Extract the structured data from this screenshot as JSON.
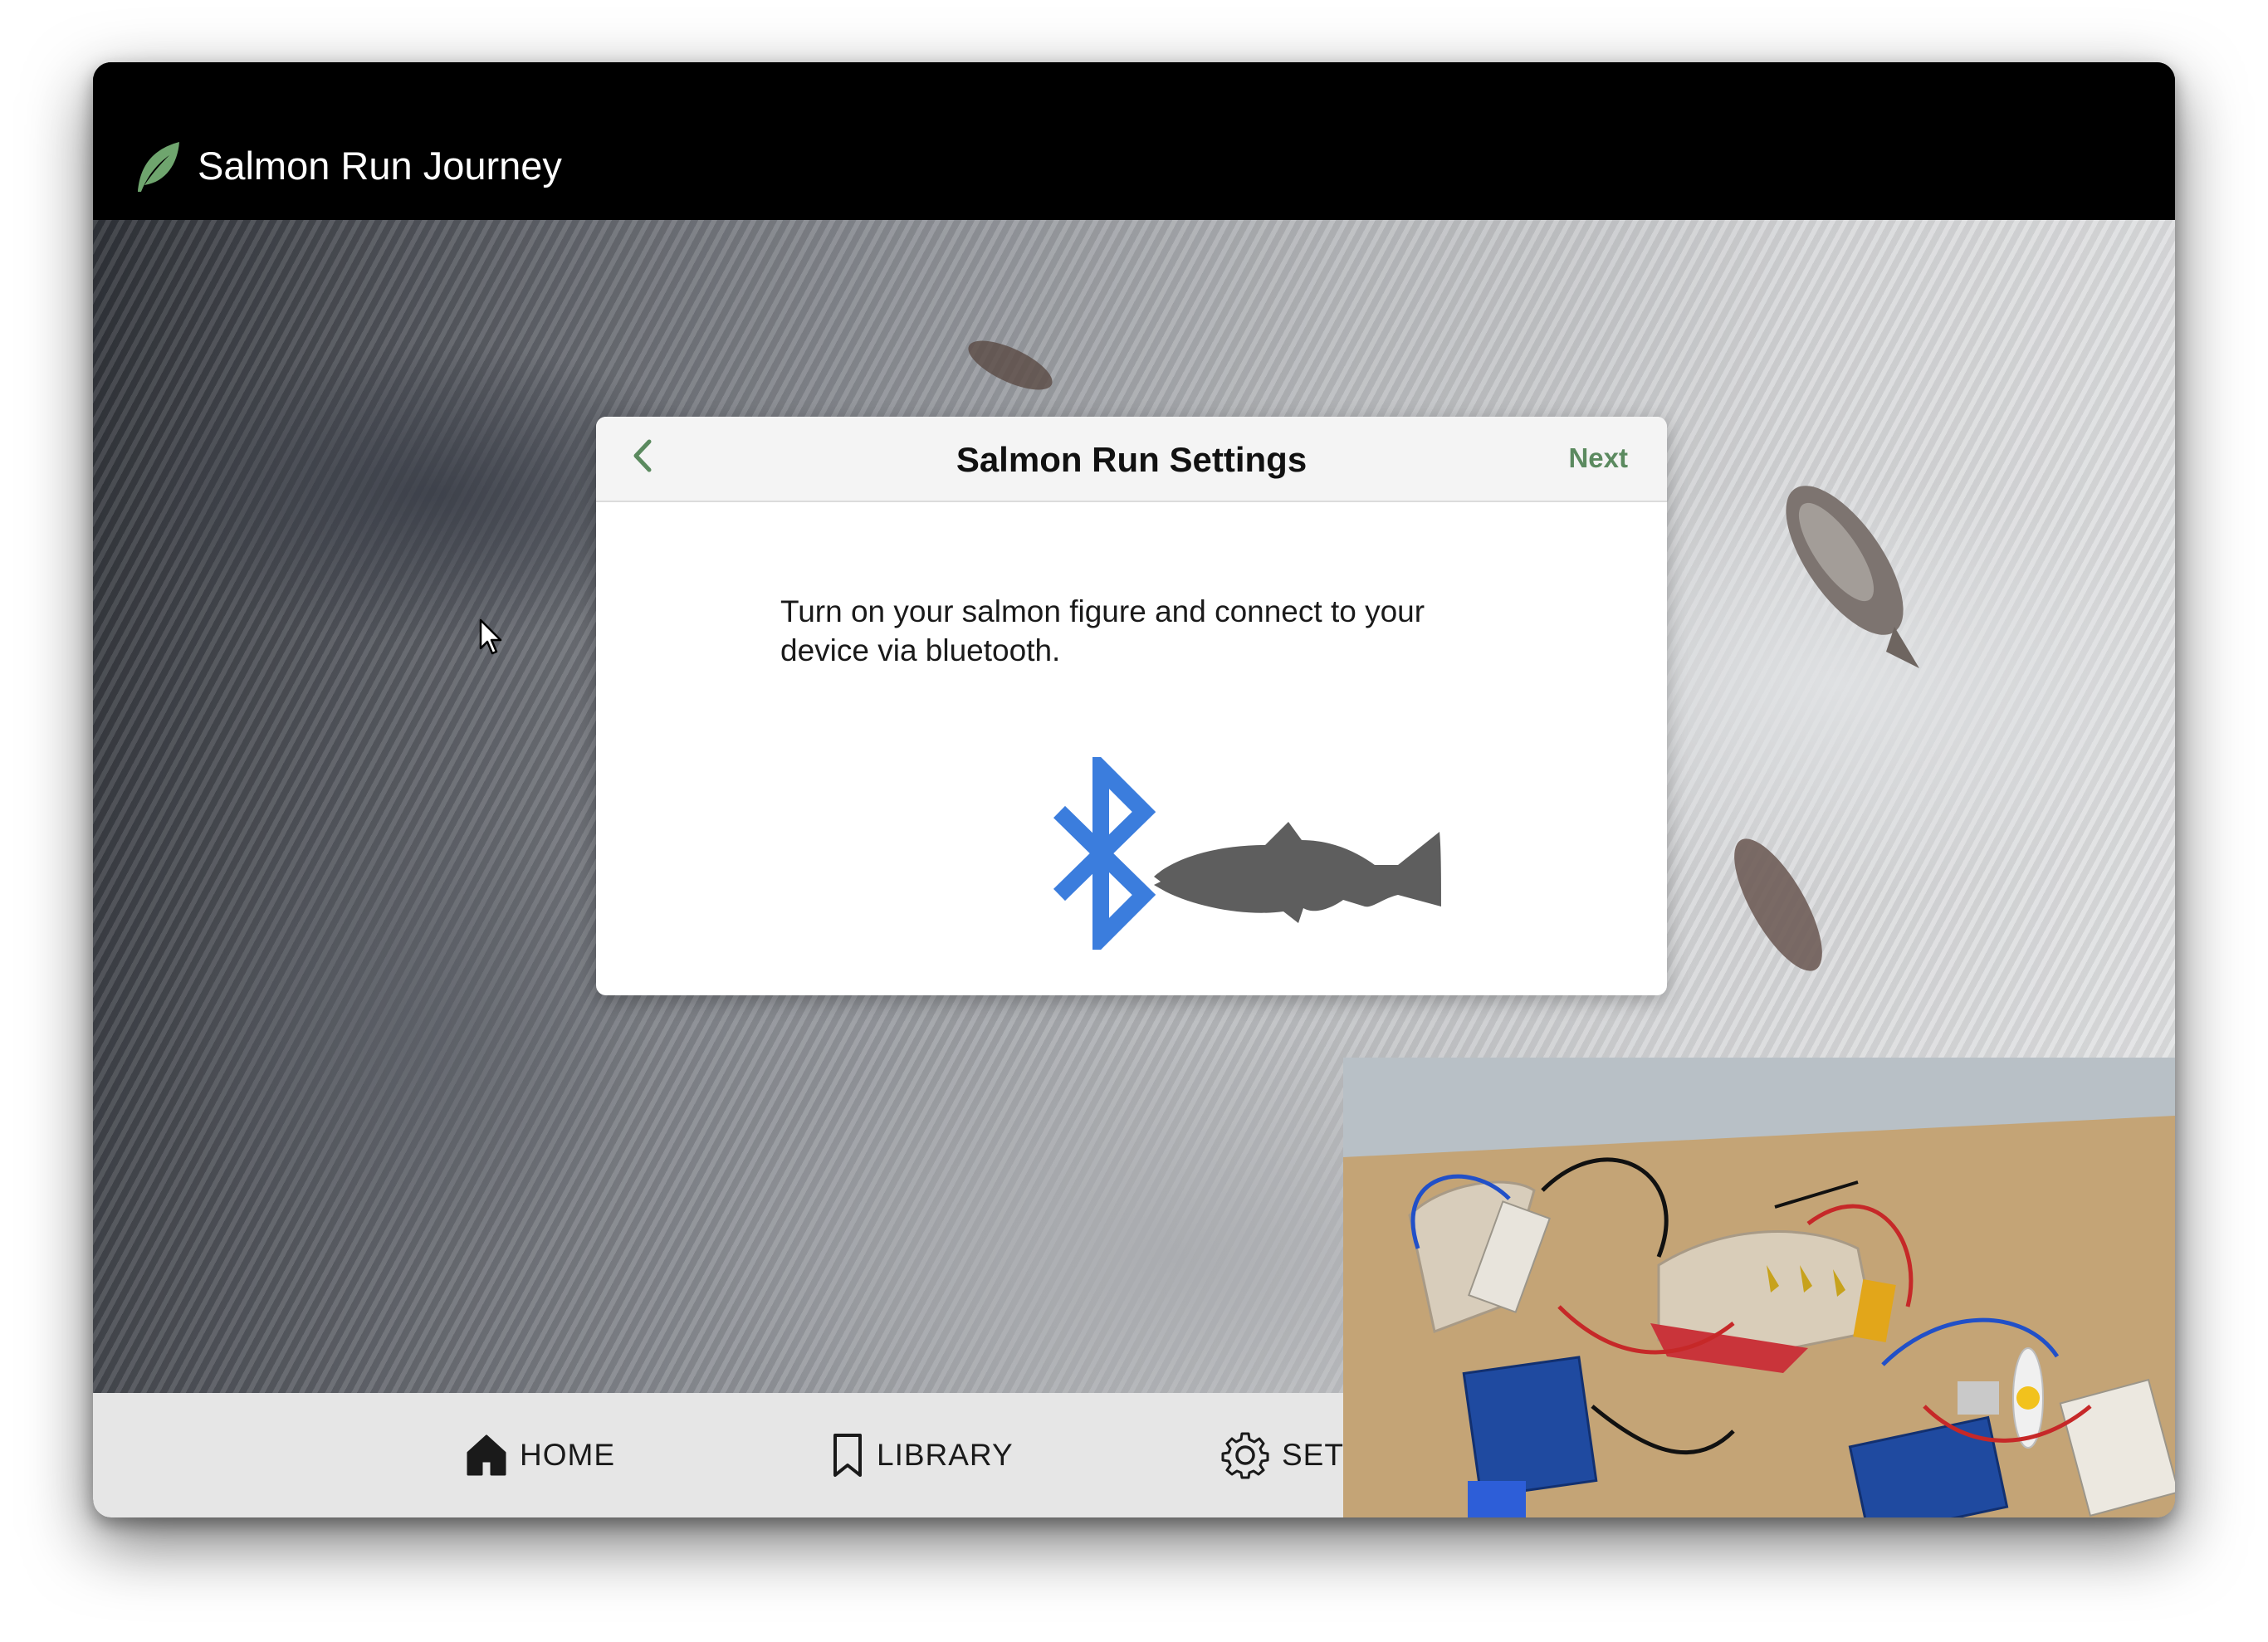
{
  "app": {
    "title": "Salmon Run Journey"
  },
  "dialog": {
    "title": "Salmon Run Settings",
    "next_label": "Next",
    "instructions": "Turn on your salmon figure and connect to your device via bluetooth."
  },
  "nav": {
    "items": [
      {
        "label": "HOME",
        "icon": "home-icon"
      },
      {
        "label": "LIBRARY",
        "icon": "bookmark-icon"
      },
      {
        "label": "SET",
        "icon": "gear-icon"
      }
    ]
  },
  "colors": {
    "accent_green": "#5b8a5f",
    "bluetooth_blue": "#3b7ddd",
    "salmon_gray": "#5e5e5e",
    "topbar": "#000000",
    "nav_bg": "#e6e6e6"
  }
}
